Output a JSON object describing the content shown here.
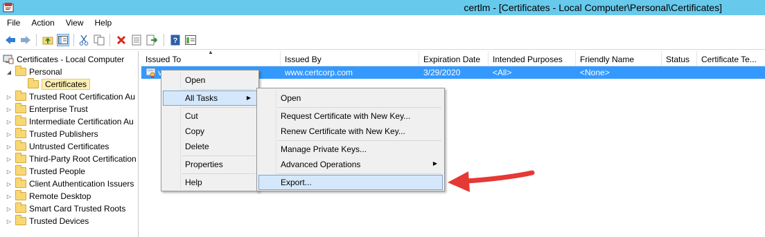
{
  "window": {
    "title": "certlm - [Certificates - Local Computer\\Personal\\Certificates]"
  },
  "menubar": [
    "File",
    "Action",
    "View",
    "Help"
  ],
  "toolbar": {
    "icons": [
      "back-arrow-icon",
      "forward-arrow-icon",
      "up-folder-icon",
      "show-hide-tree-icon",
      "cut-icon",
      "copy-icon",
      "delete-icon",
      "properties-icon",
      "export-list-icon",
      "help-icon",
      "console-view-icon"
    ],
    "colors": {
      "back": "#2f7ed8",
      "forward": "#2f7ed8",
      "delete": "#d9261c",
      "help": "#2d5ea8"
    }
  },
  "tree": {
    "root": "Certificates - Local Computer",
    "items": [
      {
        "label": "Personal",
        "level": 1,
        "expanded": true
      },
      {
        "label": "Certificates",
        "level": 2,
        "selected": true
      },
      {
        "label": "Trusted Root Certification Au",
        "level": 1
      },
      {
        "label": "Enterprise Trust",
        "level": 1
      },
      {
        "label": "Intermediate Certification Au",
        "level": 1
      },
      {
        "label": "Trusted Publishers",
        "level": 1
      },
      {
        "label": "Untrusted Certificates",
        "level": 1
      },
      {
        "label": "Third-Party Root Certification",
        "level": 1
      },
      {
        "label": "Trusted People",
        "level": 1
      },
      {
        "label": "Client Authentication Issuers",
        "level": 1
      },
      {
        "label": "Remote Desktop",
        "level": 1
      },
      {
        "label": "Smart Card Trusted Roots",
        "level": 1
      },
      {
        "label": "Trusted Devices",
        "level": 1
      }
    ]
  },
  "list": {
    "columns": [
      "Issued To",
      "Issued By",
      "Expiration Date",
      "Intended Purposes",
      "Friendly Name",
      "Status",
      "Certificate Te..."
    ],
    "rows": [
      {
        "issued_to": "v",
        "issued_by": "www.certcorp.com",
        "expiration": "3/29/2020",
        "purposes": "<All>",
        "friendly": "<None>",
        "status": "",
        "template": ""
      }
    ],
    "selected_color": "#3399ff"
  },
  "context_menu": {
    "items": [
      "Open",
      "All Tasks",
      "Cut",
      "Copy",
      "Delete",
      "Properties",
      "Help"
    ],
    "highlighted": "All Tasks"
  },
  "submenu": {
    "items": [
      "Open",
      "Request Certificate with New Key...",
      "Renew Certificate with New Key...",
      "Manage Private Keys...",
      "Advanced Operations",
      "Export..."
    ],
    "highlighted": "Export..."
  },
  "annotation": {
    "arrow_color": "#e53935"
  }
}
